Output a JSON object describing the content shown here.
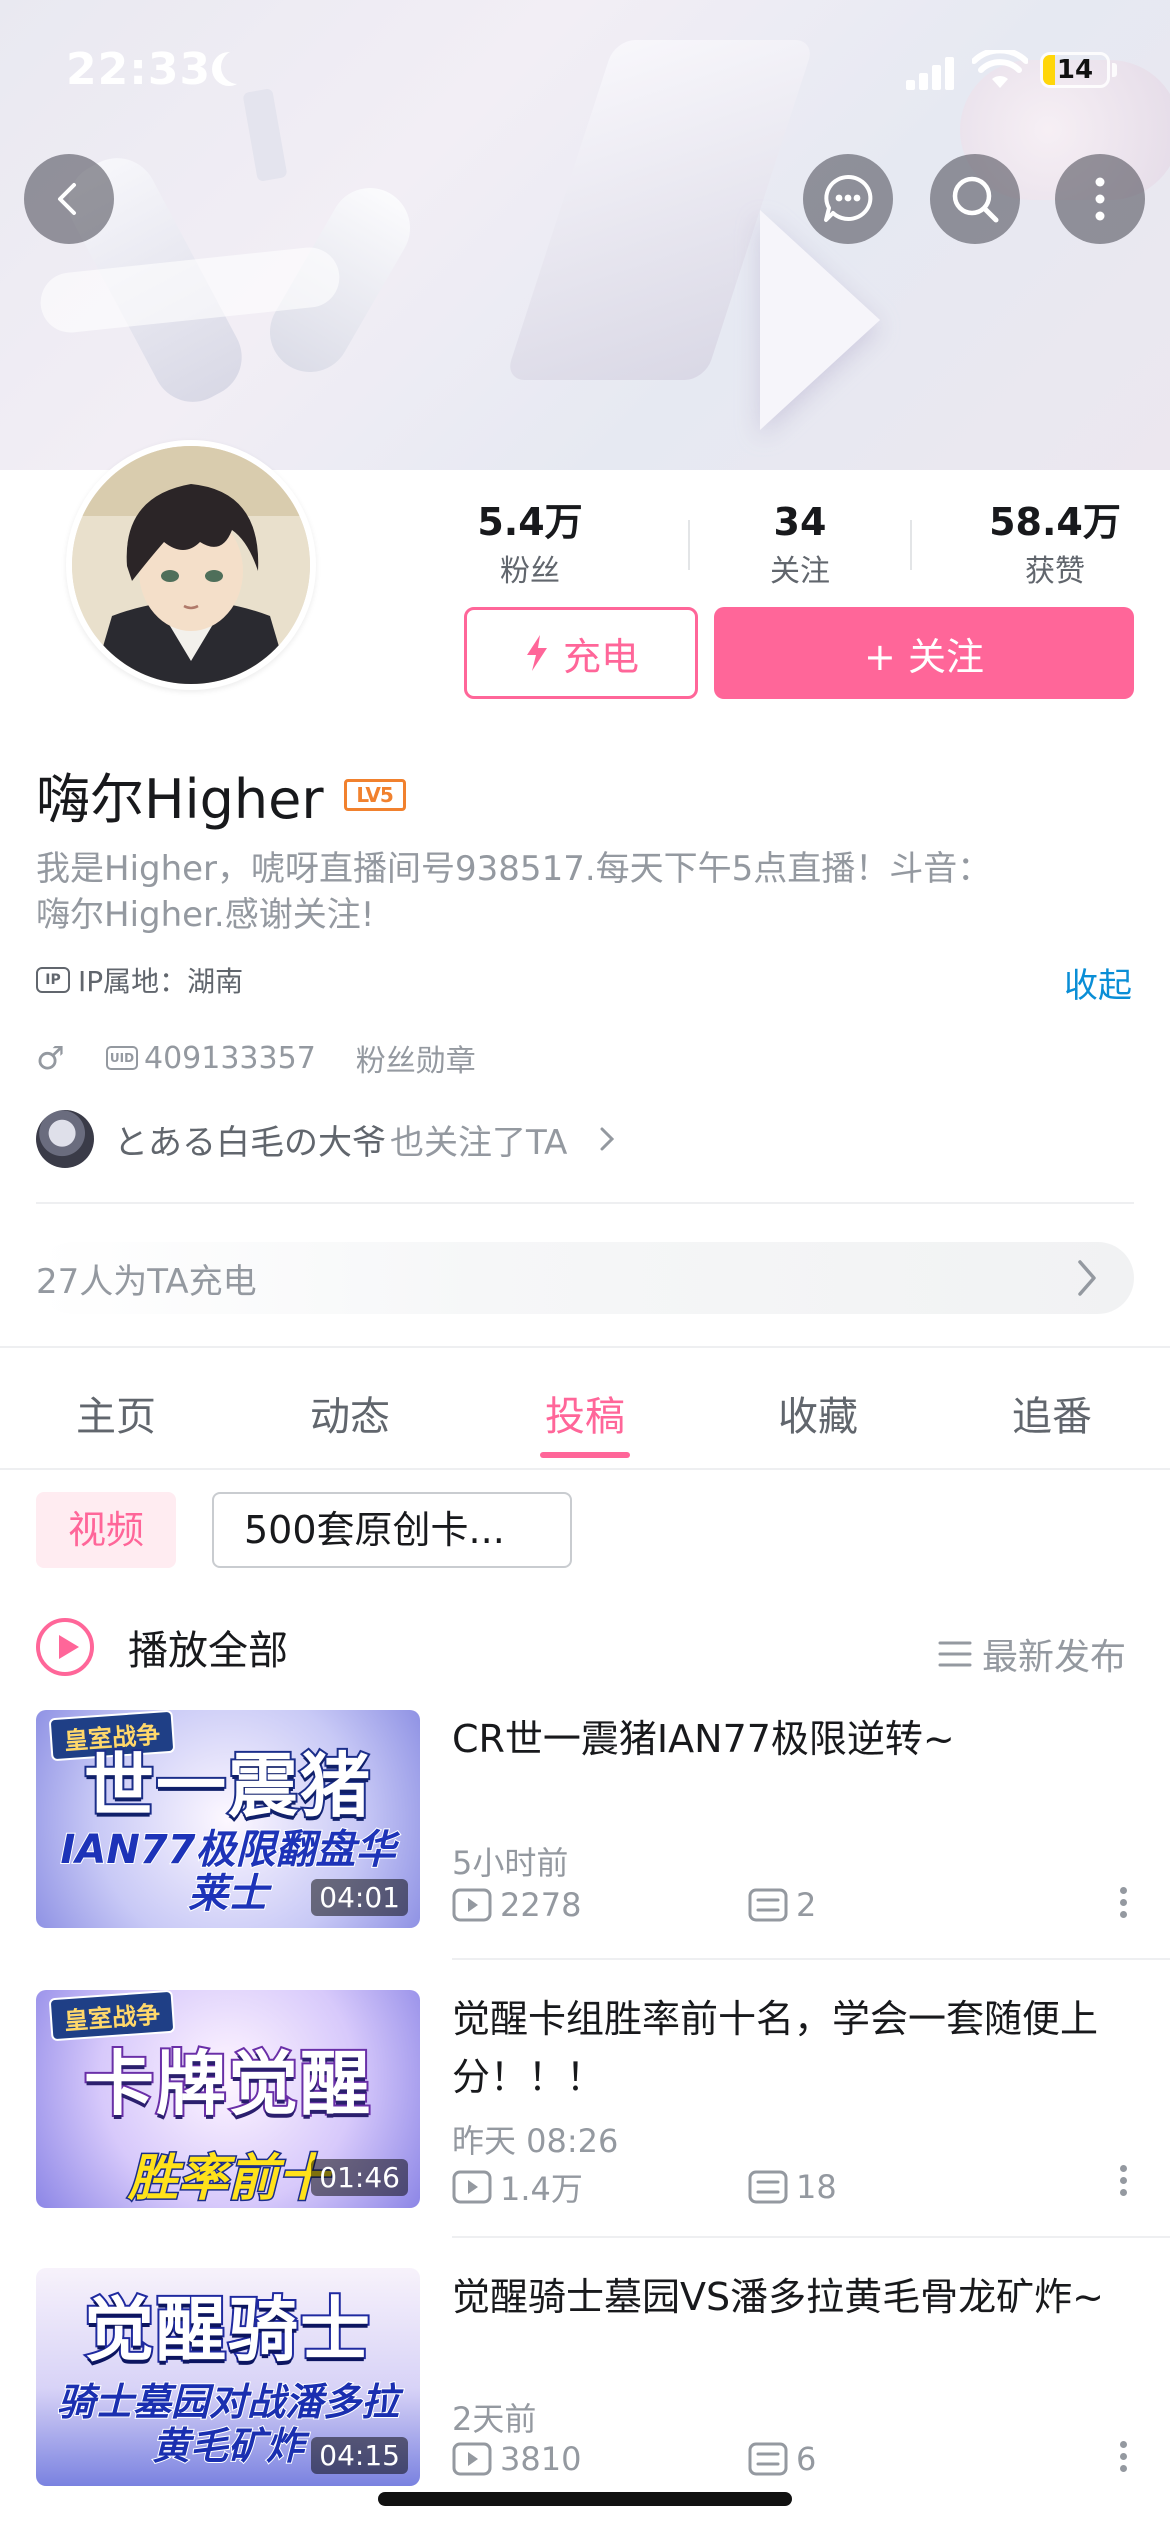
{
  "status_bar": {
    "time": "22:33",
    "battery": "14",
    "battery_level": 0.14
  },
  "colors": {
    "accent": "#ff6699",
    "link": "#0a8ed6",
    "level_badge": "#f1812e"
  },
  "top_buttons": [
    "back-icon",
    "message-icon",
    "search-icon",
    "more-icon"
  ],
  "stats": [
    {
      "value": "5.4万",
      "label": "粉丝"
    },
    {
      "value": "34",
      "label": "关注"
    },
    {
      "value": "58.4万",
      "label": "获赞"
    }
  ],
  "actions": {
    "charge": "充电",
    "follow": "+ 关注"
  },
  "profile": {
    "name": "嗨尔Higher",
    "level": "LV5",
    "bio": "我是Higher，唬呀直播间号938517.每天下午5点直播！斗音：嗨尔Higher.感谢关注!",
    "ip_tag": "IP",
    "ip_location": "IP属地：湖南",
    "collapse": "收起",
    "sex": "♂",
    "uid_tag": "UID",
    "uid": "409133357",
    "fan_medal": "粉丝勋章",
    "also_follow_name": "とある白毛の大爷",
    "also_follow_text": "也关注了TA",
    "charge_count": "27人为TA充电"
  },
  "tabs": [
    {
      "label": "主页"
    },
    {
      "label": "动态"
    },
    {
      "label": "投稿"
    },
    {
      "label": "收藏"
    },
    {
      "label": "追番"
    }
  ],
  "active_tab": "投稿",
  "filters": {
    "video": "视频",
    "collection": "500套原创卡..."
  },
  "list_header": {
    "play_all": "播放全部",
    "sort": "最新发布"
  },
  "videos": [
    {
      "title": "CR世一震猪IAN77极限逆转~",
      "time": "5小时前",
      "views": "2278",
      "comments": "2",
      "duration": "04:01",
      "thumb_tag": "皇室战争",
      "thumb_big": "世一震猪",
      "thumb_sub": "IAN77极限翻盘华莱士"
    },
    {
      "title": "觉醒卡组胜率前十名，学会一套随便上分！！！",
      "time": "昨天 08:26",
      "views": "1.4万",
      "comments": "18",
      "duration": "01:46",
      "thumb_tag": "皇室战争",
      "thumb_big": "卡牌觉醒",
      "thumb_sub": "胜率前十"
    },
    {
      "title": "觉醒骑士墓园VS潘多拉黄毛骨龙矿炸~",
      "time": "2天前",
      "views": "3810",
      "comments": "6",
      "duration": "04:15",
      "thumb_tag": "",
      "thumb_big": "觉醒骑士",
      "thumb_sub": "骑士墓园对战潘多拉黄毛矿炸"
    }
  ]
}
